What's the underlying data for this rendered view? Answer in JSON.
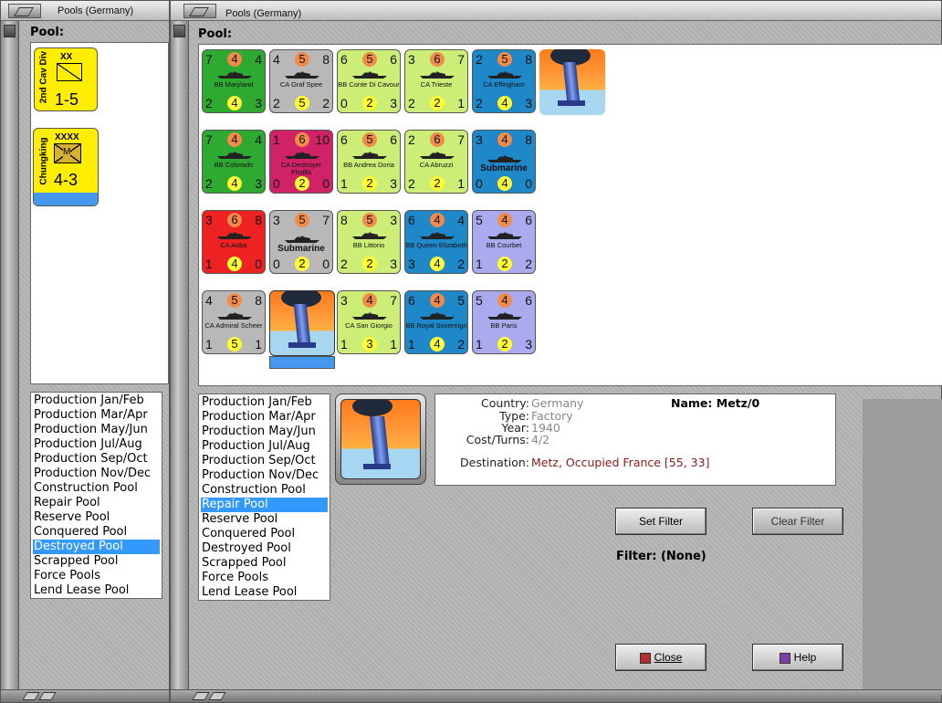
{
  "left_window": {
    "title": "Pools (Germany)",
    "pool_label": "Pool:",
    "units": [
      {
        "name": "2nd Cav Div",
        "size": "XX",
        "strength": "1-5",
        "color": "#ffee00"
      },
      {
        "name": "Chungking",
        "size": "XXXX",
        "type": "M",
        "strength": "4-3",
        "color": "#ffee00"
      }
    ],
    "pool_list": [
      "Production Jan/Feb",
      "Production Mar/Apr",
      "Production May/Jun",
      "Production Jul/Aug",
      "Production Sep/Oct",
      "Production Nov/Dec",
      "Construction Pool",
      "Repair Pool",
      "Reserve Pool",
      "Conquered Pool",
      "Destroyed Pool",
      "Scrapped Pool",
      "Force Pools",
      "Lend Lease Pool"
    ],
    "selected": "Destroyed Pool"
  },
  "main_window": {
    "title": "Pools (Germany)",
    "pool_label": "Pool:",
    "counters": [
      {
        "kind": "ship",
        "name": "BB Maryland",
        "tl": "7",
        "tc": "4",
        "tr": "4",
        "bl": "2",
        "bc": "4",
        "br": "3",
        "color": "#2eaa33"
      },
      {
        "kind": "ship",
        "name": "CA Graf Spee",
        "tl": "4",
        "tc": "5",
        "tr": "8",
        "bl": "2",
        "bc": "5",
        "br": "2",
        "color": "#b8b8b8"
      },
      {
        "kind": "ship",
        "name": "BB Conte Di Cavour",
        "tl": "6",
        "tc": "5",
        "tr": "6",
        "bl": "0",
        "bc": "2",
        "br": "3",
        "color": "#ccee77"
      },
      {
        "kind": "ship",
        "name": "CA Trieste",
        "tl": "3",
        "tc": "6",
        "tr": "7",
        "bl": "2",
        "bc": "2",
        "br": "1",
        "color": "#ccee77"
      },
      {
        "kind": "ship",
        "name": "CA Effingham",
        "tl": "2",
        "tc": "5",
        "tr": "8",
        "bl": "2",
        "bc": "4",
        "br": "3",
        "color": "#1e88c8"
      },
      {
        "kind": "factory"
      },
      {
        "kind": "ship",
        "name": "BB Colorado",
        "tl": "7",
        "tc": "4",
        "tr": "4",
        "bl": "2",
        "bc": "4",
        "br": "3",
        "color": "#2eaa33"
      },
      {
        "kind": "ship",
        "name": "CA Destroyer Flotilla",
        "tl": "1",
        "tc": "6",
        "tr": "10",
        "bl": "0",
        "bc": "2",
        "br": "0",
        "color": "#d02266"
      },
      {
        "kind": "ship",
        "name": "BB Andrea Doria",
        "tl": "6",
        "tc": "5",
        "tr": "6",
        "bl": "1",
        "bc": "2",
        "br": "3",
        "color": "#ccee77"
      },
      {
        "kind": "ship",
        "name": "CA Abruzzi",
        "tl": "2",
        "tc": "6",
        "tr": "7",
        "bl": "2",
        "bc": "2",
        "br": "1",
        "color": "#ccee77"
      },
      {
        "kind": "ship",
        "name": "Submarine",
        "big": true,
        "tl": "3",
        "tc": "4",
        "tr": "8",
        "bl": "0",
        "bc": "4",
        "br": "0",
        "color": "#1e88c8"
      },
      {
        "kind": "ship",
        "name": "CA Aoba",
        "tl": "3",
        "tc": "6",
        "tr": "8",
        "bl": "1",
        "bc": "4",
        "br": "0",
        "color": "#ee2222"
      },
      {
        "kind": "ship",
        "name": "Submarine",
        "big": true,
        "tl": "3",
        "tc": "5",
        "tr": "7",
        "bl": "0",
        "bc": "2",
        "br": "0",
        "color": "#b8b8b8"
      },
      {
        "kind": "ship",
        "name": "BB Littorio",
        "tl": "8",
        "tc": "5",
        "tr": "3",
        "bl": "2",
        "bc": "2",
        "br": "3",
        "color": "#ccee77"
      },
      {
        "kind": "ship",
        "name": "BB Queen Elizabeth",
        "tl": "6",
        "tc": "4",
        "tr": "4",
        "bl": "3",
        "bc": "4",
        "br": "2",
        "color": "#1e88c8"
      },
      {
        "kind": "ship",
        "name": "BB Courbet",
        "tl": "5",
        "tc": "4",
        "tr": "6",
        "bl": "1",
        "bc": "2",
        "br": "2",
        "color": "#aaaaee"
      },
      {
        "kind": "ship",
        "name": "CA Admiral Scheer",
        "tl": "4",
        "tc": "5",
        "tr": "8",
        "bl": "1",
        "bc": "5",
        "br": "1",
        "color": "#b8b8b8"
      },
      {
        "kind": "factory",
        "selected": true
      },
      {
        "kind": "ship",
        "name": "CA San Giorgio",
        "tl": "3",
        "tc": "4",
        "tr": "7",
        "bl": "1",
        "bc": "3",
        "br": "1",
        "color": "#ccee77"
      },
      {
        "kind": "ship",
        "name": "BB Royal Sovereign",
        "tl": "6",
        "tc": "4",
        "tr": "5",
        "bl": "1",
        "bc": "4",
        "br": "2",
        "color": "#1e88c8"
      },
      {
        "kind": "ship",
        "name": "BB Paris",
        "tl": "5",
        "tc": "4",
        "tr": "6",
        "bl": "1",
        "bc": "2",
        "br": "3",
        "color": "#aaaaee"
      }
    ],
    "pool_list": [
      "Production Jan/Feb",
      "Production Mar/Apr",
      "Production May/Jun",
      "Production Jul/Aug",
      "Production Sep/Oct",
      "Production Nov/Dec",
      "Construction Pool",
      "Repair Pool",
      "Reserve Pool",
      "Conquered Pool",
      "Destroyed Pool",
      "Scrapped Pool",
      "Force Pools",
      "Lend Lease Pool"
    ],
    "selected": "Repair Pool",
    "details": {
      "country_label": "Country:",
      "country": "Germany",
      "type_label": "Type:",
      "type": "Factory",
      "year_label": "Year:",
      "year": "1940",
      "cost_label": "Cost/Turns:",
      "cost": "4/2",
      "destination_label": "Destination:",
      "destination": "Metz, Occupied France [55, 33]",
      "name_label": "Name: Metz/0"
    },
    "buttons": {
      "set_filter": "Set Filter",
      "clear_filter": "Clear Filter",
      "close": "Close",
      "help": "Help"
    },
    "filter_text": "Filter: (None)"
  }
}
